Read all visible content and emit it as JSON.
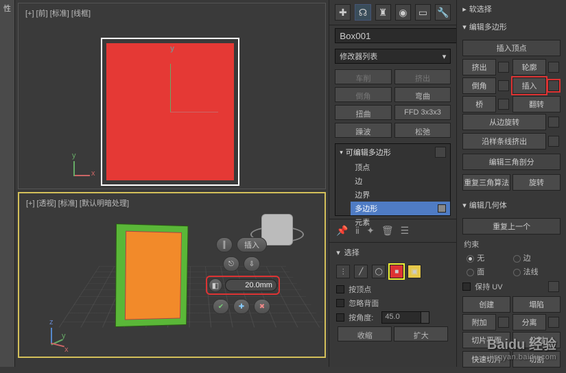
{
  "tab_label": "性",
  "viewports": {
    "front_label": "[+] [前] [标准] [线框]",
    "persp_label": "[+] [透视] [标准] [默认明暗处理]",
    "axes": {
      "x": "x",
      "y": "y",
      "z": "z"
    }
  },
  "caddy": {
    "label": "插入",
    "value": "20.0mm"
  },
  "object_name": "Box001",
  "modifier_list_label": "修改器列表",
  "modifier_buttons": {
    "b1": "车削",
    "b2": "挤出",
    "b3": "倒角",
    "b4": "弯曲",
    "b5": "扭曲",
    "b6": "FFD 3x3x3",
    "b7": "躁波",
    "b8": "松弛"
  },
  "stack": {
    "header": "可编辑多边形",
    "items": [
      "顶点",
      "边",
      "边界",
      "多边形",
      "元素"
    ],
    "selected_index": 3
  },
  "selection": {
    "title": "选择",
    "by_vertex": "按顶点",
    "ignore_backface": "忽略背面",
    "by_angle": "按角度:",
    "angle_value": "45.0",
    "shrink": "收缩",
    "grow": "扩大"
  },
  "right": {
    "soft_sel": "软选择",
    "edit_poly": "编辑多边形",
    "insert_vertex": "插入顶点",
    "extrude": "挤出",
    "outline": "轮廓",
    "bevel": "倒角",
    "inset": "插入",
    "bridge": "桥",
    "flip": "翻转",
    "hinge": "从边旋转",
    "extrude_spline": "沿样条线挤出",
    "edit_tri": "编辑三角剖分",
    "retri": "重复三角算法",
    "turn": "旋转",
    "edit_geom": "编辑几何体",
    "repeat_last": "重复上一个",
    "constraints": "约束",
    "c_none": "无",
    "c_edge": "边",
    "c_face": "面",
    "c_normal": "法线",
    "preserve_uv": "保持 UV",
    "create": "创建",
    "collapse": "塌陷",
    "attach": "附加",
    "detach": "分离",
    "slice_plane": "切片平面",
    "split": "分割",
    "quickslice": "快速切片",
    "cut": "切割"
  },
  "watermark": {
    "brand": "Baidu 经验",
    "url": "jingyan.baidu.com"
  }
}
